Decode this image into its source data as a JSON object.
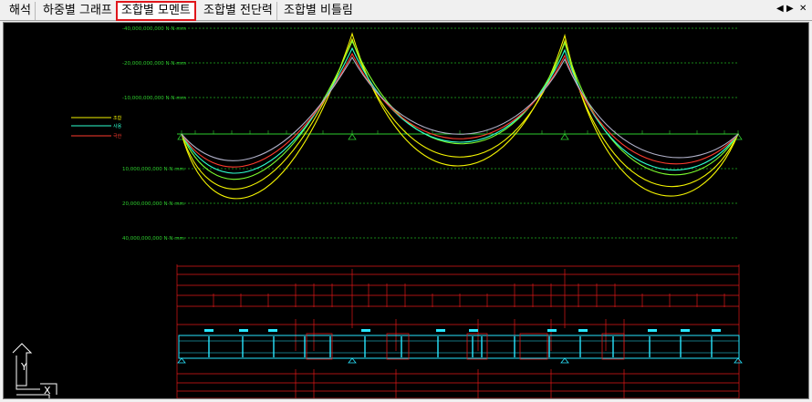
{
  "tabs": [
    {
      "label": "해석",
      "active": false
    },
    {
      "label": "하중별 그래프",
      "active": false
    },
    {
      "label": "조합별 모멘트",
      "active": true
    },
    {
      "label": "조합별 전단력",
      "active": false
    },
    {
      "label": "조합별 비틀림",
      "active": false
    }
  ],
  "nav": {
    "prev_icon": "◀",
    "next_icon": "▶",
    "close_icon": "✕"
  },
  "colors": {
    "axis_label": "#2ecc2e",
    "gridline": "#1fae1f",
    "envelope_yellow": "#f4f400",
    "envelope_green": "#7dff2e",
    "envelope_cyan": "#2effd0",
    "envelope_red": "#ff3b2e",
    "envelope_gray": "#b0b0c8",
    "section_red": "#e01818",
    "girder_cyan": "#29e6ff"
  },
  "axis_labels": [
    "-40,000,000,000 N·N·mm",
    "-20,000,000,000 N·N·mm",
    "-10,000,000,000 N·N·mm",
    "10,000,000,000 N·N·mm",
    "20,000,000,000 N·N·mm",
    "40,000,000,000 N·N·mm"
  ],
  "legend": [
    "조합",
    "사용",
    "극한"
  ],
  "axis_indicator": {
    "y_label": "Y",
    "x_label": "X"
  }
}
